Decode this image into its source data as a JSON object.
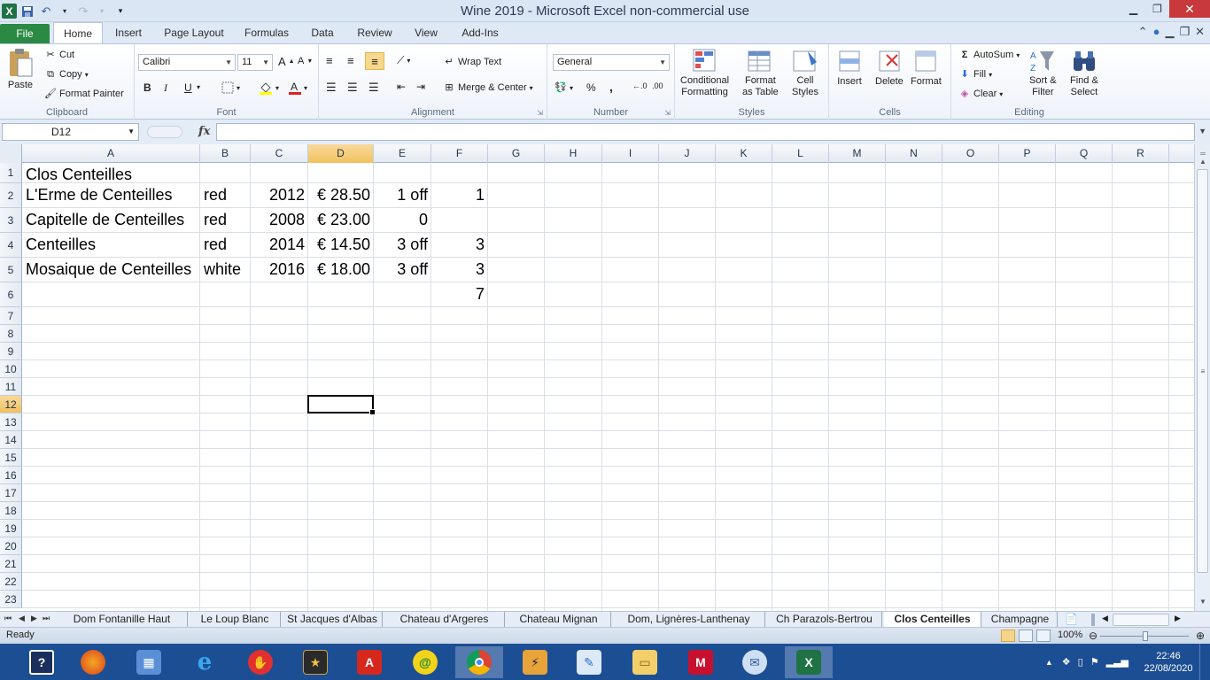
{
  "window": {
    "title": "Wine 2019  -  Microsoft Excel non-commercial use"
  },
  "ribbon_tabs": [
    {
      "label": "File"
    },
    {
      "label": "Home"
    },
    {
      "label": "Insert"
    },
    {
      "label": "Page Layout"
    },
    {
      "label": "Formulas"
    },
    {
      "label": "Data"
    },
    {
      "label": "Review"
    },
    {
      "label": "View"
    },
    {
      "label": "Add-Ins"
    }
  ],
  "clipboard": {
    "paste": "Paste",
    "cut": "Cut",
    "copy": "Copy",
    "format_painter": "Format Painter",
    "label": "Clipboard"
  },
  "font": {
    "name": "Calibri",
    "size": "11",
    "bold": "B",
    "italic": "I",
    "underline": "U",
    "label": "Font"
  },
  "alignment": {
    "wrap": "Wrap Text",
    "merge": "Merge & Center",
    "label": "Alignment"
  },
  "number": {
    "format": "General",
    "percent": "%",
    "comma": ",",
    "label": "Number"
  },
  "styles": {
    "conditional": "Conditional",
    "conditional2": "Formatting",
    "format_table": "Format",
    "format_table2": "as Table",
    "cell_styles": "Cell",
    "cell_styles2": "Styles",
    "label": "Styles"
  },
  "cells": {
    "insert": "Insert",
    "delete": "Delete",
    "format": "Format",
    "label": "Cells"
  },
  "editing": {
    "autosum": "AutoSum",
    "fill": "Fill",
    "clear": "Clear",
    "sort": "Sort &",
    "sort2": "Filter",
    "find": "Find &",
    "find2": "Select",
    "label": "Editing"
  },
  "formula_bar": {
    "name_box": "D12",
    "fx": "fx",
    "formula": ""
  },
  "columns": [
    "A",
    "B",
    "C",
    "D",
    "E",
    "F",
    "G",
    "H",
    "I",
    "J",
    "K",
    "L",
    "M",
    "N",
    "O",
    "P",
    "Q",
    "R"
  ],
  "rows": [
    "1",
    "2",
    "3",
    "4",
    "5",
    "6",
    "7",
    "8",
    "9",
    "10",
    "11",
    "12",
    "13",
    "14",
    "15",
    "16",
    "17",
    "18",
    "19",
    "20",
    "21",
    "22",
    "23"
  ],
  "cells_data": {
    "r1": {
      "a": "Clos Centeilles"
    },
    "r2": {
      "a": "L'Erme de Centeilles",
      "b": "red",
      "c": "2012",
      "d": "€ 28.50",
      "e": "1 off",
      "f": "1"
    },
    "r3": {
      "a": "Capitelle de Centeilles",
      "b": "red",
      "c": "2008",
      "d": "€ 23.00",
      "e": "0"
    },
    "r4": {
      "a": "Centeilles",
      "b": "red",
      "c": "2014",
      "d": "€ 14.50",
      "e": "3 off",
      "f": "3"
    },
    "r5": {
      "a": "Mosaique de Centeilles",
      "b": "white",
      "c": "2016",
      "d": "€ 18.00",
      "e": "3 off",
      "f": "3"
    },
    "r6": {
      "f": "7"
    }
  },
  "sheet_tabs": [
    {
      "label": "Dom Fontanille Haut"
    },
    {
      "label": "Le Loup Blanc"
    },
    {
      "label": "St Jacques d'Albas"
    },
    {
      "label": "Chateau d'Argeres"
    },
    {
      "label": "Chateau Mignan"
    },
    {
      "label": "Dom, Lignères-Lanthenay"
    },
    {
      "label": "Ch Parazols-Bertrou"
    },
    {
      "label": "Clos Centeilles"
    },
    {
      "label": "Champagne"
    }
  ],
  "status": {
    "ready": "Ready",
    "zoom": "100%"
  },
  "taskbar": {
    "time": "22:46",
    "date": "22/08/2020"
  },
  "colors": {
    "accent": "#1f7244",
    "file_tab": "#2a8a43",
    "selection": "#f1c15f",
    "taskbar": "#1c4e94"
  }
}
